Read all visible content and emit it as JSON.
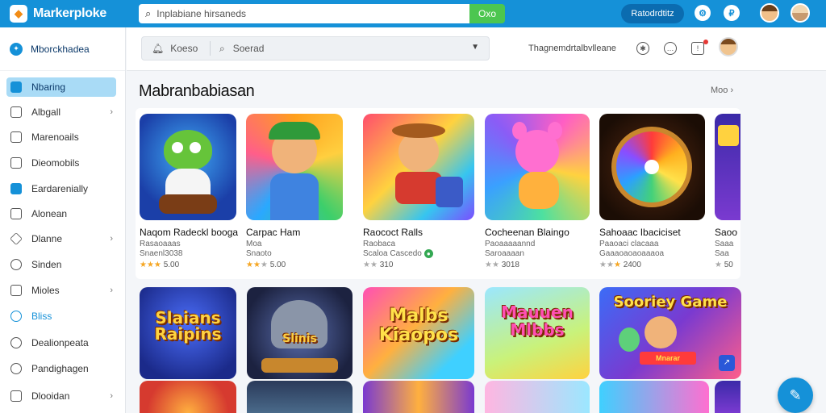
{
  "topbar": {
    "app_name": "Markerploke",
    "search_placeholder": "Inplabiane hirsaneds",
    "search_button": "Oxo",
    "cta_button": "Ratodrdtitz",
    "icon1": "gear-icon",
    "icon2": "profile-icon",
    "brand_color": "#1591d8",
    "button_color": "#4cc650"
  },
  "sidebar": {
    "header": "Mborckhadea",
    "items": [
      {
        "label": "Nbaring",
        "icon": "storefront-icon"
      },
      {
        "label": "Albgall",
        "icon": "grid-icon"
      },
      {
        "label": "Marenoails",
        "icon": "tag-icon"
      },
      {
        "label": "Dieomobils",
        "icon": "document-icon"
      },
      {
        "label": "Eardarenially",
        "icon": "app-icon"
      },
      {
        "label": "Alonean",
        "icon": "image-icon"
      },
      {
        "label": "Dlanne",
        "icon": "diamond-icon"
      },
      {
        "label": "Sinden",
        "icon": "settings-icon"
      },
      {
        "label": "Mioles",
        "icon": "folder-icon"
      },
      {
        "label": "Bliss",
        "icon": "globe-icon"
      },
      {
        "label": "Dealionpeata",
        "icon": "circle-icon"
      },
      {
        "label": "Pandighagen",
        "icon": "user-icon"
      },
      {
        "label": "Dlooidan",
        "icon": "layers-icon"
      }
    ]
  },
  "mainhead": {
    "filter1": "Koeso",
    "filter2": "Soerad",
    "right_text": "Thagnemdrtalbvlleane"
  },
  "section": {
    "title": "Mabranbabiasan",
    "more": "Moo"
  },
  "row1": [
    {
      "title": "Naqom Radeckl booga",
      "line1": "Rasaoaaas",
      "line2": "Snaenl3038",
      "rating": "5.00"
    },
    {
      "title": "Carpac Ham",
      "line1": "Moa",
      "line2": "Snaoto",
      "rating": "5.00"
    },
    {
      "title": "Raococt Ralls",
      "line1": "Raobaca",
      "line2": "Scaloa Cascedo",
      "rating": "310"
    },
    {
      "title": "Cocheenan Blaingo",
      "line1": "Paoaaaaannd",
      "line2": "Saroaaaan",
      "rating": "3018"
    },
    {
      "title": "Sahoaac Ibaciciset",
      "line1": "Paaoaci clacaaa",
      "line2": "Gaaaoaoaoaaaoa",
      "rating": "2400"
    },
    {
      "title": "Saoo",
      "line1": "Saaa",
      "line2": "Saa",
      "rating": "50"
    }
  ],
  "row2": [
    {
      "art_title": "Slaians Raipins"
    },
    {
      "art_title": "Slinis"
    },
    {
      "art_title": "Malbs Kiaopos"
    },
    {
      "art_title": "Mauuen Mlbbs"
    },
    {
      "art_title": "Sooriey Game",
      "art_sub": "Mnarar"
    }
  ]
}
